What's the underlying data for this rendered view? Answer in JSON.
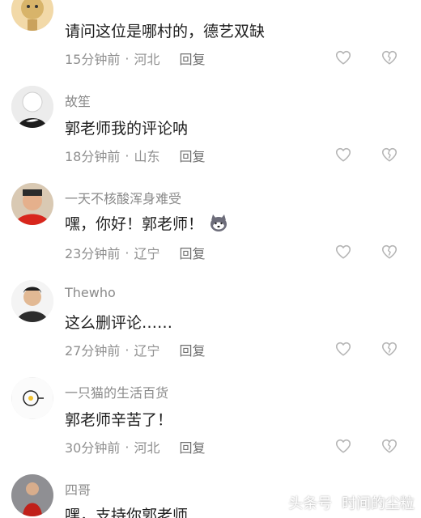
{
  "comments": [
    {
      "username": "",
      "text": "请问这位是哪村的，德艺双缺",
      "time": "15分钟前",
      "location": "河北",
      "reply": "回复"
    },
    {
      "username": "故笙",
      "text": "郭老师我的评论呐",
      "time": "18分钟前",
      "location": "山东",
      "reply": "回复"
    },
    {
      "username": "一天不核酸浑身难受",
      "text": "嘿，你好！郭老师！",
      "time": "23分钟前",
      "location": "辽宁",
      "reply": "回复"
    },
    {
      "username": "Thewho",
      "text": "这么删评论……",
      "time": "27分钟前",
      "location": "辽宁",
      "reply": "回复"
    },
    {
      "username": "一只猫的生活百货",
      "text": "郭老师辛苦了！",
      "time": "30分钟前",
      "location": "河北",
      "reply": "回复"
    },
    {
      "username": "四哥",
      "text": "嘿，支持你郭老师",
      "time": "",
      "location": "",
      "reply": ""
    }
  ],
  "meta_separator": "·",
  "watermark": {
    "brand": "头条号",
    "source": "时间的尘粒"
  },
  "icons": {
    "like": "heart-outline-icon",
    "dislike": "broken-heart-icon",
    "emoji": "husky-dog-emoji-icon"
  },
  "colors": {
    "username": "#8a8a8a",
    "text": "#1f1f1f",
    "meta": "#8f8f8f",
    "icon": "#b5b5b5"
  }
}
